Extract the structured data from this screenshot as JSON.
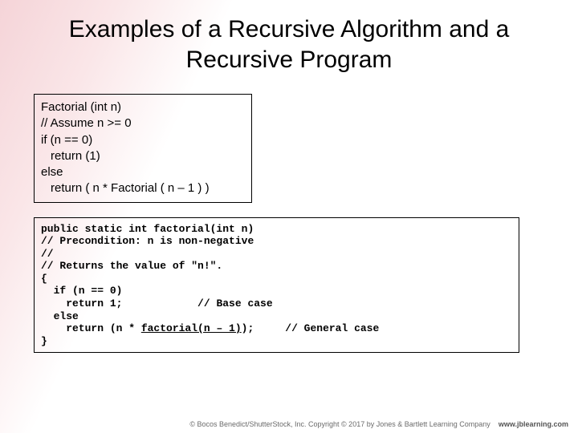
{
  "title": "Examples of a Recursive Algorithm and a Recursive Program",
  "algo": {
    "l1": "Factorial (int n)",
    "l2": "// Assume n >= 0",
    "l3": "if (n == 0)",
    "l4": "return (1)",
    "l5": "else",
    "l6": "return ( n * Factorial ( n – 1 ) )"
  },
  "code": {
    "l1": "public static int factorial(int n)",
    "l2": "// Precondition: n is non-negative",
    "l3": "//",
    "l4": "// Returns the value of \"n!\".",
    "l5": "{",
    "l6a": "  if (n == 0)",
    "l7a": "    return 1;            ",
    "l7b": "// Base case",
    "l8a": "  else",
    "l9a": "    return (n * ",
    "l9u": "factorial(n – 1)",
    "l9b": ");     ",
    "l9c": "// General case",
    "l10": "}"
  },
  "footer": {
    "credit": "© Bocos Benedict/ShutterStock, Inc. Copyright © 2017 by Jones & Bartlett Learning Company",
    "site": "www.jblearning.com"
  }
}
